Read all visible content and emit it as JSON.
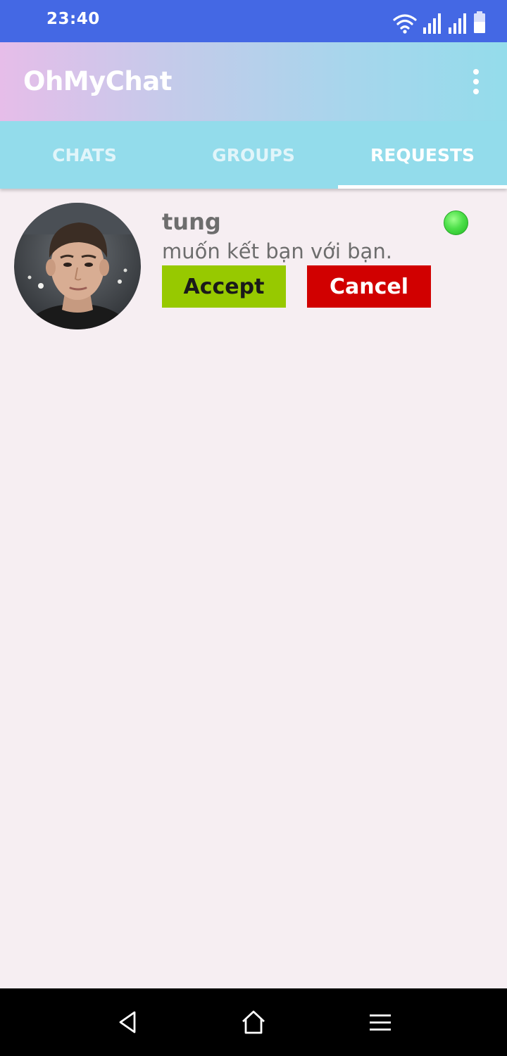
{
  "status_bar": {
    "time": "23:40",
    "icons": [
      "wifi-icon",
      "signal-icon",
      "signal-icon",
      "battery-icon"
    ]
  },
  "app_bar": {
    "title": "OhMyChat",
    "menu_icon": "more-vert-icon"
  },
  "tabs": [
    {
      "label": "CHATS",
      "active": false
    },
    {
      "label": "GROUPS",
      "active": false
    },
    {
      "label": "REQUESTS",
      "active": true
    }
  ],
  "requests": [
    {
      "name": "tung",
      "message": "muốn kết bạn với bạn.",
      "online": true,
      "accept_label": "Accept",
      "cancel_label": "Cancel"
    }
  ],
  "nav_bar": {
    "buttons": [
      "back-icon",
      "home-icon",
      "menu-icon"
    ]
  },
  "colors": {
    "status_bar": "#4468e4",
    "tab_bar": "#93dceb",
    "background": "#f6eef2",
    "accept": "#97c900",
    "cancel": "#d10000",
    "online": "#4ee04a"
  }
}
